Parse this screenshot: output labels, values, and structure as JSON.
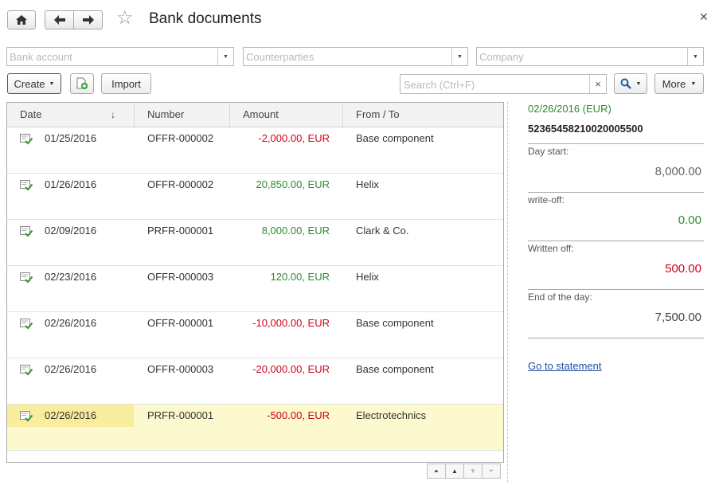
{
  "header": {
    "title": "Bank documents"
  },
  "filters": {
    "bank_account_placeholder": "Bank account",
    "counterparties_placeholder": "Counterparties",
    "company_placeholder": "Company"
  },
  "toolbar": {
    "create_label": "Create",
    "import_label": "Import",
    "search_placeholder": "Search (Ctrl+F)",
    "more_label": "More"
  },
  "table": {
    "columns": [
      "Date",
      "Number",
      "Amount",
      "From / To"
    ],
    "rows": [
      {
        "date": "01/25/2016",
        "number": "OFFR-000002",
        "amount": "-2,000.00, EUR",
        "sign": "neg",
        "counterparty": "Base component"
      },
      {
        "date": "01/26/2016",
        "number": "OFFR-000002",
        "amount": "20,850.00, EUR",
        "sign": "pos",
        "counterparty": "Helix"
      },
      {
        "date": "02/09/2016",
        "number": "PRFR-000001",
        "amount": "8,000.00, EUR",
        "sign": "pos",
        "counterparty": "Clark & Co."
      },
      {
        "date": "02/23/2016",
        "number": "OFFR-000003",
        "amount": "120.00, EUR",
        "sign": "pos",
        "counterparty": "Helix"
      },
      {
        "date": "02/26/2016",
        "number": "OFFR-000001",
        "amount": "-10,000.00, EUR",
        "sign": "neg",
        "counterparty": "Base component"
      },
      {
        "date": "02/26/2016",
        "number": "OFFR-000003",
        "amount": "-20,000.00, EUR",
        "sign": "neg",
        "counterparty": "Base component"
      },
      {
        "date": "02/26/2016",
        "number": "PRFR-000001",
        "amount": "-500.00, EUR",
        "sign": "neg",
        "counterparty": "Electrotechnics",
        "selected": true
      }
    ]
  },
  "details": {
    "date_currency": "02/26/2016 (EUR)",
    "account_number": "52365458210020005500",
    "day_start_label": "Day start:",
    "day_start_value": "8,000.00",
    "writeoff_label": "write-off:",
    "writeoff_value": "0.00",
    "written_off_label": "Written off:",
    "written_off_value": "500.00",
    "end_of_day_label": "End of the day:",
    "end_of_day_value": "7,500.00",
    "go_to_statement_label": "Go to statement"
  },
  "colors": {
    "negative": "#d0021b",
    "positive": "#2e8b2e",
    "selected_row": "#fbf9cd",
    "link": "#1f4f9e"
  }
}
